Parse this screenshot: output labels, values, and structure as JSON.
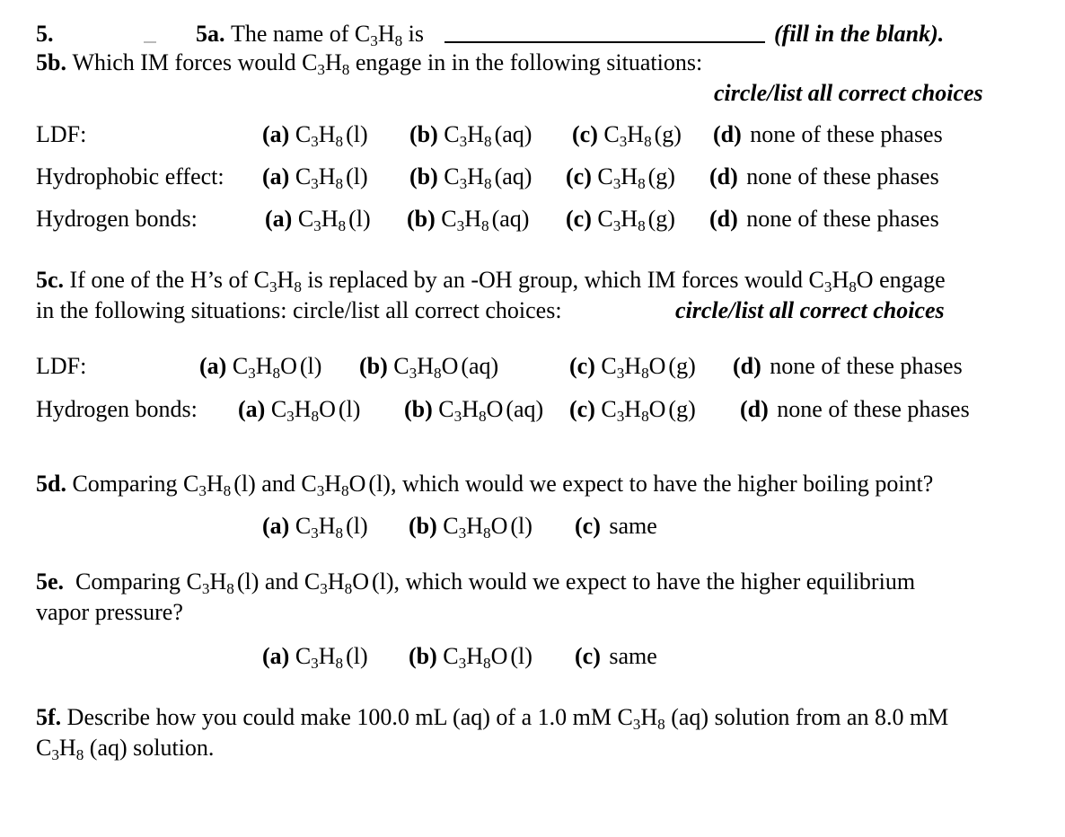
{
  "document": {
    "question_number": "5.",
    "subscript_note": "chemical formulas use subscripts"
  },
  "q5a": {
    "label": "5a.",
    "text_before_blank": "The name of",
    "formula": "C3H8",
    "text_after_formula": "is",
    "blank": "",
    "hint": "(fill in the blank)."
  },
  "q5b": {
    "label": "5b.",
    "prompt_before": "Which IM forces would",
    "formula": "C3H8",
    "prompt_after": "engage in in the following situations:",
    "instruction": "circle/list all correct choices",
    "rows": [
      {
        "row_label": "LDF:",
        "options": [
          {
            "letter": "(a)",
            "formula": "C3H8",
            "phase": "(l)"
          },
          {
            "letter": "(b)",
            "formula": "C3H8",
            "phase": "(aq)"
          },
          {
            "letter": "(c)",
            "formula": "C3H8",
            "phase": "(g)"
          },
          {
            "letter": "(d)",
            "formula": "",
            "phase": "none of these phases"
          }
        ]
      },
      {
        "row_label": "Hydrophobic effect:",
        "options": [
          {
            "letter": "(a)",
            "formula": "C3H8",
            "phase": "(l)"
          },
          {
            "letter": "(b)",
            "formula": "C3H8",
            "phase": "(aq)"
          },
          {
            "letter": "(c)",
            "formula": "C3H8",
            "phase": "(g)"
          },
          {
            "letter": "(d)",
            "formula": "",
            "phase": "none of these phases"
          }
        ]
      },
      {
        "row_label": "Hydrogen bonds:",
        "options": [
          {
            "letter": "(a)",
            "formula": "C3H8",
            "phase": "(l)"
          },
          {
            "letter": "(b)",
            "formula": "C3H8",
            "phase": "(aq)"
          },
          {
            "letter": "(c)",
            "formula": "C3H8",
            "phase": "(g)"
          },
          {
            "letter": "(d)",
            "formula": "",
            "phase": "none of these phases"
          }
        ]
      }
    ]
  },
  "q5c": {
    "label": "5c.",
    "line1_a": "If one of the H’s of",
    "formula1": "C3H8",
    "line1_b": "is replaced by an -OH group, which IM forces would",
    "formula2": "C3H8O",
    "line1_c": "engage",
    "line2": "in the following situations: circle/list all correct choices:",
    "instruction": "circle/list all correct choices",
    "rows": [
      {
        "row_label": "LDF:",
        "options": [
          {
            "letter": "(a)",
            "formula": "C3H8O",
            "phase": "(l)"
          },
          {
            "letter": "(b)",
            "formula": "C3H8O",
            "phase": "(aq)"
          },
          {
            "letter": "(c)",
            "formula": "C3H8O",
            "phase": "(g)"
          },
          {
            "letter": "(d)",
            "formula": "",
            "phase": "none of these phases"
          }
        ]
      },
      {
        "row_label": "Hydrogen bonds:",
        "options": [
          {
            "letter": "(a)",
            "formula": "C3H8O",
            "phase": "(l)"
          },
          {
            "letter": "(b)",
            "formula": "C3H8O",
            "phase": "(aq)"
          },
          {
            "letter": "(c)",
            "formula": "C3H8O",
            "phase": "(g)"
          },
          {
            "letter": "(d)",
            "formula": "",
            "phase": "none of these phases"
          }
        ]
      }
    ]
  },
  "q5d": {
    "label": "5d.",
    "text_a": "Comparing",
    "formula1": "C3H8",
    "phase1": "(l)",
    "text_b": "and",
    "formula2": "C3H8O",
    "phase2": "(l),",
    "text_c": "which would we expect to have the higher boiling point?",
    "options": [
      {
        "letter": "(a)",
        "formula": "C3H8",
        "phase": "(l)"
      },
      {
        "letter": "(b)",
        "formula": "C3H8O",
        "phase": "(l)"
      },
      {
        "letter": "(c)",
        "formula": "",
        "phase": "same"
      }
    ]
  },
  "q5e": {
    "label": "5e.",
    "text_a": "Comparing",
    "formula1": "C3H8",
    "phase1": "(l)",
    "text_b": "and",
    "formula2": "C3H8O",
    "phase2": "(l),",
    "text_c": "which would we expect to have the higher equilibrium",
    "line2": "vapor pressure?",
    "options": [
      {
        "letter": "(a)",
        "formula": "C3H8",
        "phase": "(l)"
      },
      {
        "letter": "(b)",
        "formula": "C3H8O",
        "phase": "(l)"
      },
      {
        "letter": "(c)",
        "formula": "",
        "phase": "same"
      }
    ]
  },
  "q5f": {
    "label": "5f.",
    "line1_a": "Describe how you could make 100.0 mL (aq) of a 1.0 mM",
    "formula1": "C3H8",
    "line1_b": "(aq) solution from an 8.0 mM",
    "formula2": "C3H8",
    "line2_b": "(aq) solution."
  }
}
